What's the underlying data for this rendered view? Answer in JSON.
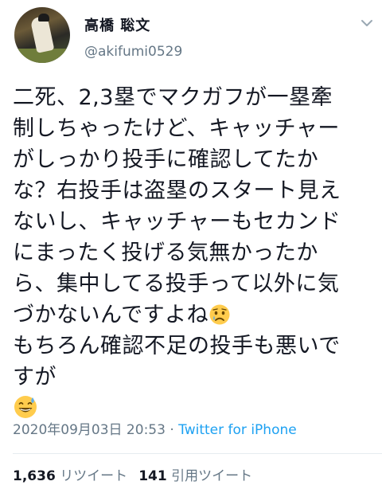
{
  "author": {
    "display_name": "高橋 聡文",
    "handle": "@akifumi0529"
  },
  "tweet": {
    "lines": [
      "二死、2,3塁でマクガフが一塁牽",
      "制しちゃったけど、キャッチャー",
      "がしっかり投手に確認してたか",
      "な？右投手は盗塁のスタート見え",
      "ないし、キャッチャーもセカンド",
      "にまったく投げる気無かったか",
      "ら、集中してる投手って以外に気",
      "づかないんですよね",
      "もちろん確認不足の投手も悪いで",
      "すが"
    ],
    "emoji_after_line_8": "crying-face-emoji",
    "emoji_last": "grinning-sweat-emoji"
  },
  "meta": {
    "timestamp": "2020年09月03日 20:53",
    "separator": " · ",
    "source": "Twitter for iPhone"
  },
  "stats": {
    "retweets_count": "1,636",
    "retweets_label": "リツイート",
    "quotes_count": "141",
    "quotes_label": "引用ツイート"
  },
  "icons": {
    "chevron": "chevron-down-icon"
  },
  "colors": {
    "text": "#141823",
    "secondary": "#657786",
    "link": "#1da1f2",
    "divider": "#e6ecf0"
  }
}
